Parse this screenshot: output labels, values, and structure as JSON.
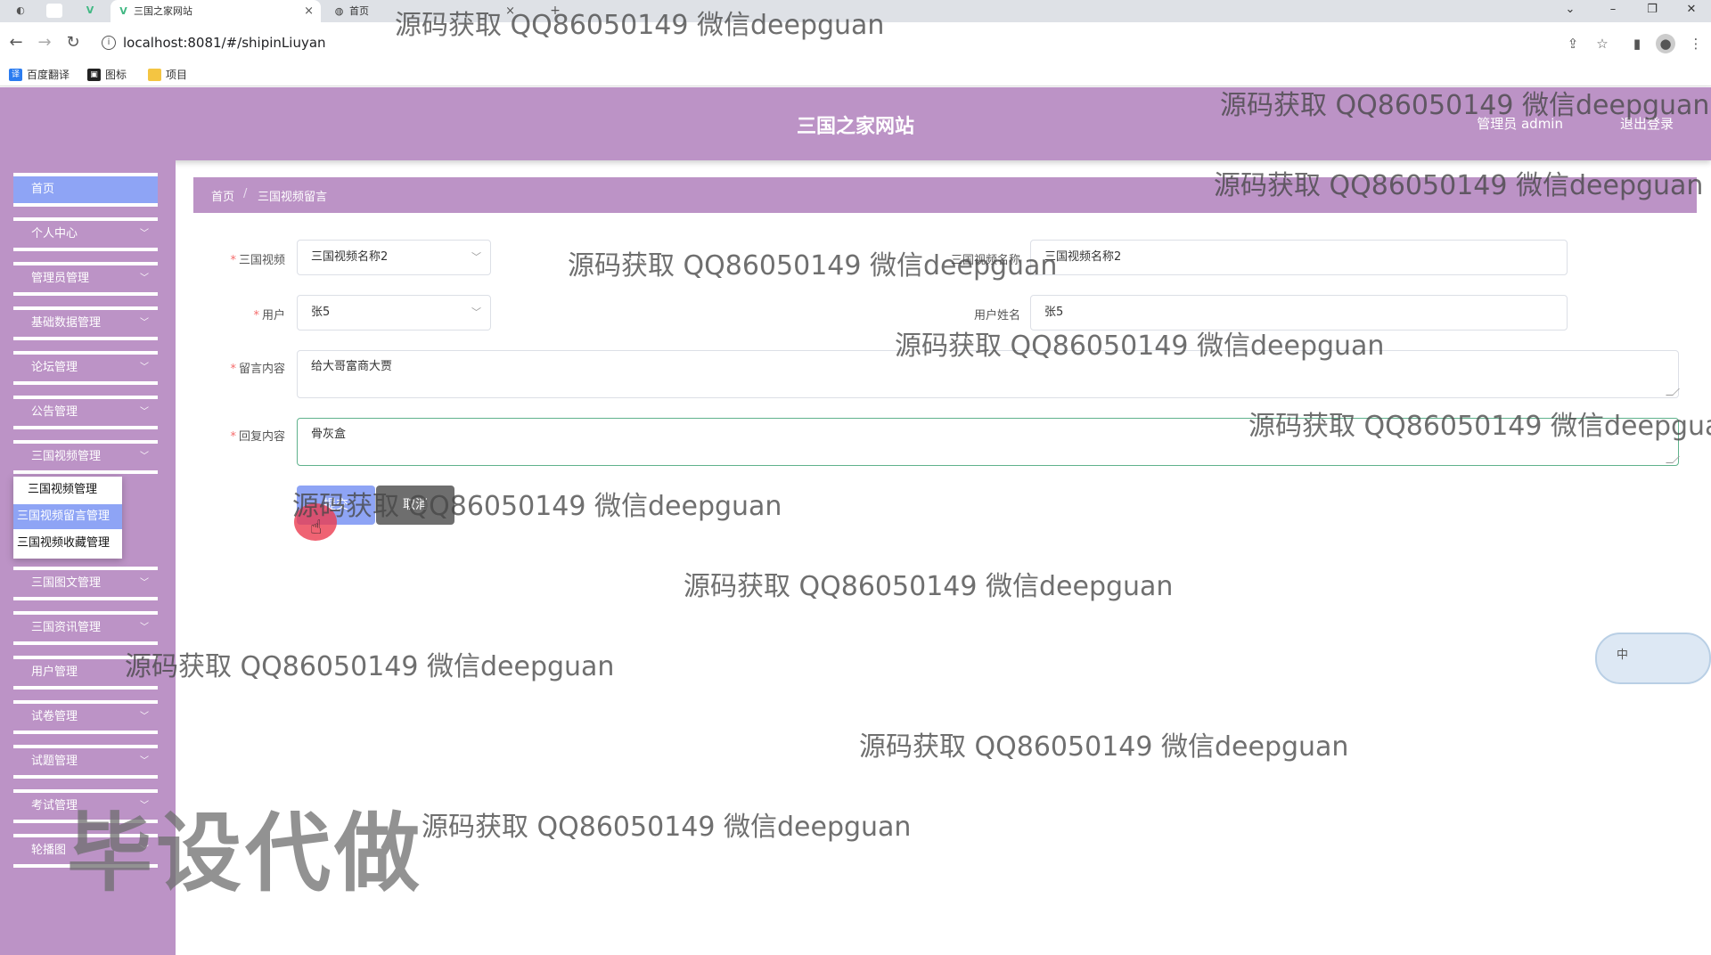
{
  "browser": {
    "tabs": [
      {
        "label": "三国之家网站",
        "active": true
      },
      {
        "label": "首页",
        "active": false
      }
    ],
    "new_tab": "+",
    "url": "localhost:8081/#/shipinLiuyan",
    "bookmarks": [
      "百度翻译",
      "图标",
      "项目"
    ]
  },
  "header": {
    "title": "三国之家网站",
    "user": "管理员 admin",
    "logout": "退出登录"
  },
  "sidebar": {
    "items": [
      {
        "label": "首页",
        "expandable": false
      },
      {
        "label": "个人中心",
        "expandable": true
      },
      {
        "label": "管理员管理",
        "expandable": true
      },
      {
        "label": "基础数据管理",
        "expandable": true
      },
      {
        "label": "论坛管理",
        "expandable": true
      },
      {
        "label": "公告管理",
        "expandable": true
      },
      {
        "label": "三国视频管理",
        "expandable": true
      },
      {
        "label": "三国图文管理",
        "expandable": true
      },
      {
        "label": "三国资讯管理",
        "expandable": true
      },
      {
        "label": "用户管理",
        "expandable": false
      },
      {
        "label": "试卷管理",
        "expandable": true
      },
      {
        "label": "试题管理",
        "expandable": true
      },
      {
        "label": "考试管理",
        "expandable": true
      },
      {
        "label": "轮播图",
        "expandable": true
      }
    ],
    "submenu": [
      {
        "label": "三国视频管理",
        "selected": false
      },
      {
        "label": "三国视频留言管理",
        "selected": true
      },
      {
        "label": "三国视频收藏管理",
        "selected": false
      }
    ]
  },
  "breadcrumb": {
    "home": "首页",
    "separator": "/",
    "current": "三国视频留言"
  },
  "form": {
    "video_label": "三国视频",
    "video_value": "三国视频名称2",
    "video_name_label": "三国视频名称",
    "video_name_value": "三国视频名称2",
    "user_label": "用户",
    "user_value": "张5",
    "user_name_label": "用户姓名",
    "user_name_value": "张5",
    "message_label": "留言内容",
    "message_value": "给大哥富商大贾",
    "reply_label": "回复内容",
    "reply_value": "骨灰盒",
    "submit": "提交",
    "cancel": "取消"
  },
  "ime": {
    "label": "中"
  },
  "watermarks": {
    "text": "源码获取 QQ86050149 微信deepguan",
    "big": "毕设代做"
  },
  "colors": {
    "accent": "#bc93c6",
    "button_primary": "#8ea4f5",
    "button_cancel": "#6e6e6e",
    "required": "#f56c6c"
  }
}
